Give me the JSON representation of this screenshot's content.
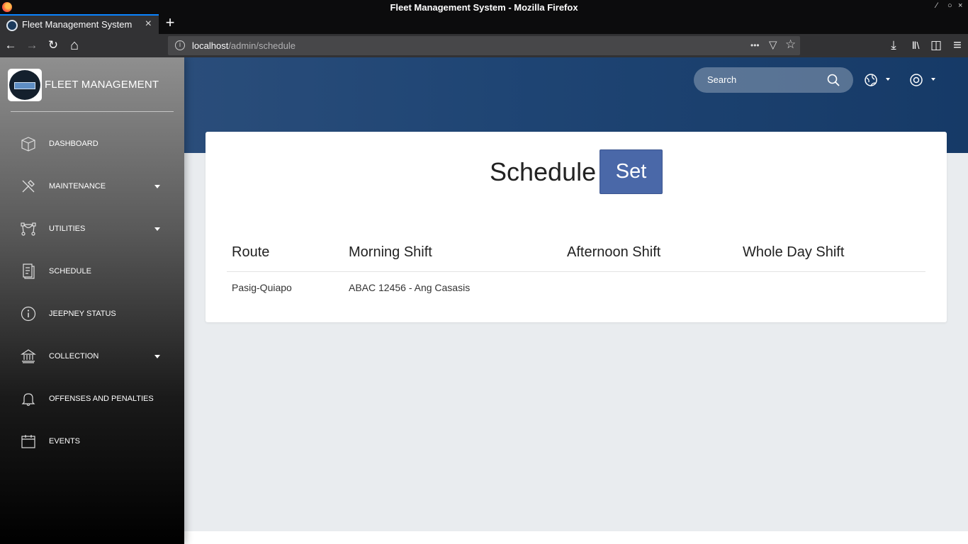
{
  "window": {
    "title": "Fleet Management System - Mozilla Firefox",
    "controls": [
      "⁄",
      "○",
      "×"
    ]
  },
  "browser": {
    "tab_title": "Fleet Management System",
    "tab_close": "×",
    "new_tab": "+",
    "url_host": "localhost",
    "url_path": "/admin/schedule",
    "urlbar_actions": "•••",
    "info_icon": "i",
    "nav": {
      "back": "←",
      "forward": "→",
      "reload": "↻",
      "home": "⌂"
    },
    "toolbar": {
      "download": "⤓",
      "library": "Ⅱ\\",
      "sidebar": "◫",
      "menu": "≡"
    },
    "pocket": "▽",
    "bookmark": "☆"
  },
  "sidebar": {
    "brand": "FLEET MANAGEMENT",
    "items": [
      {
        "label": "DASHBOARD",
        "icon": "box-icon",
        "dropdown": false
      },
      {
        "label": "MAINTENANCE",
        "icon": "tools-icon",
        "dropdown": true
      },
      {
        "label": "UTILITIES",
        "icon": "vector-icon",
        "dropdown": true
      },
      {
        "label": "SCHEDULE",
        "icon": "document-icon",
        "dropdown": false
      },
      {
        "label": "JEEPNEY STATUS",
        "icon": "info-icon",
        "dropdown": false
      },
      {
        "label": "COLLECTION",
        "icon": "bank-icon",
        "dropdown": true
      },
      {
        "label": "OFFENSES AND PENALTIES",
        "icon": "bell-icon",
        "dropdown": false
      },
      {
        "label": "EVENTS",
        "icon": "calendar-icon",
        "dropdown": false
      }
    ]
  },
  "header": {
    "search_placeholder": "Search"
  },
  "main": {
    "title": "Schedule",
    "set_button": "Set",
    "table": {
      "headers": [
        "Route",
        "Morning Shift",
        "Afternoon Shift",
        "Whole Day Shift"
      ],
      "rows": [
        [
          "Pasig-Quiapo",
          "ABAC 12456 - Ang Casasis",
          "",
          ""
        ]
      ]
    }
  },
  "colors": {
    "accent": "#4a68a8",
    "header_band": "#1f4574",
    "tab_highlight": "#0a84ff"
  }
}
